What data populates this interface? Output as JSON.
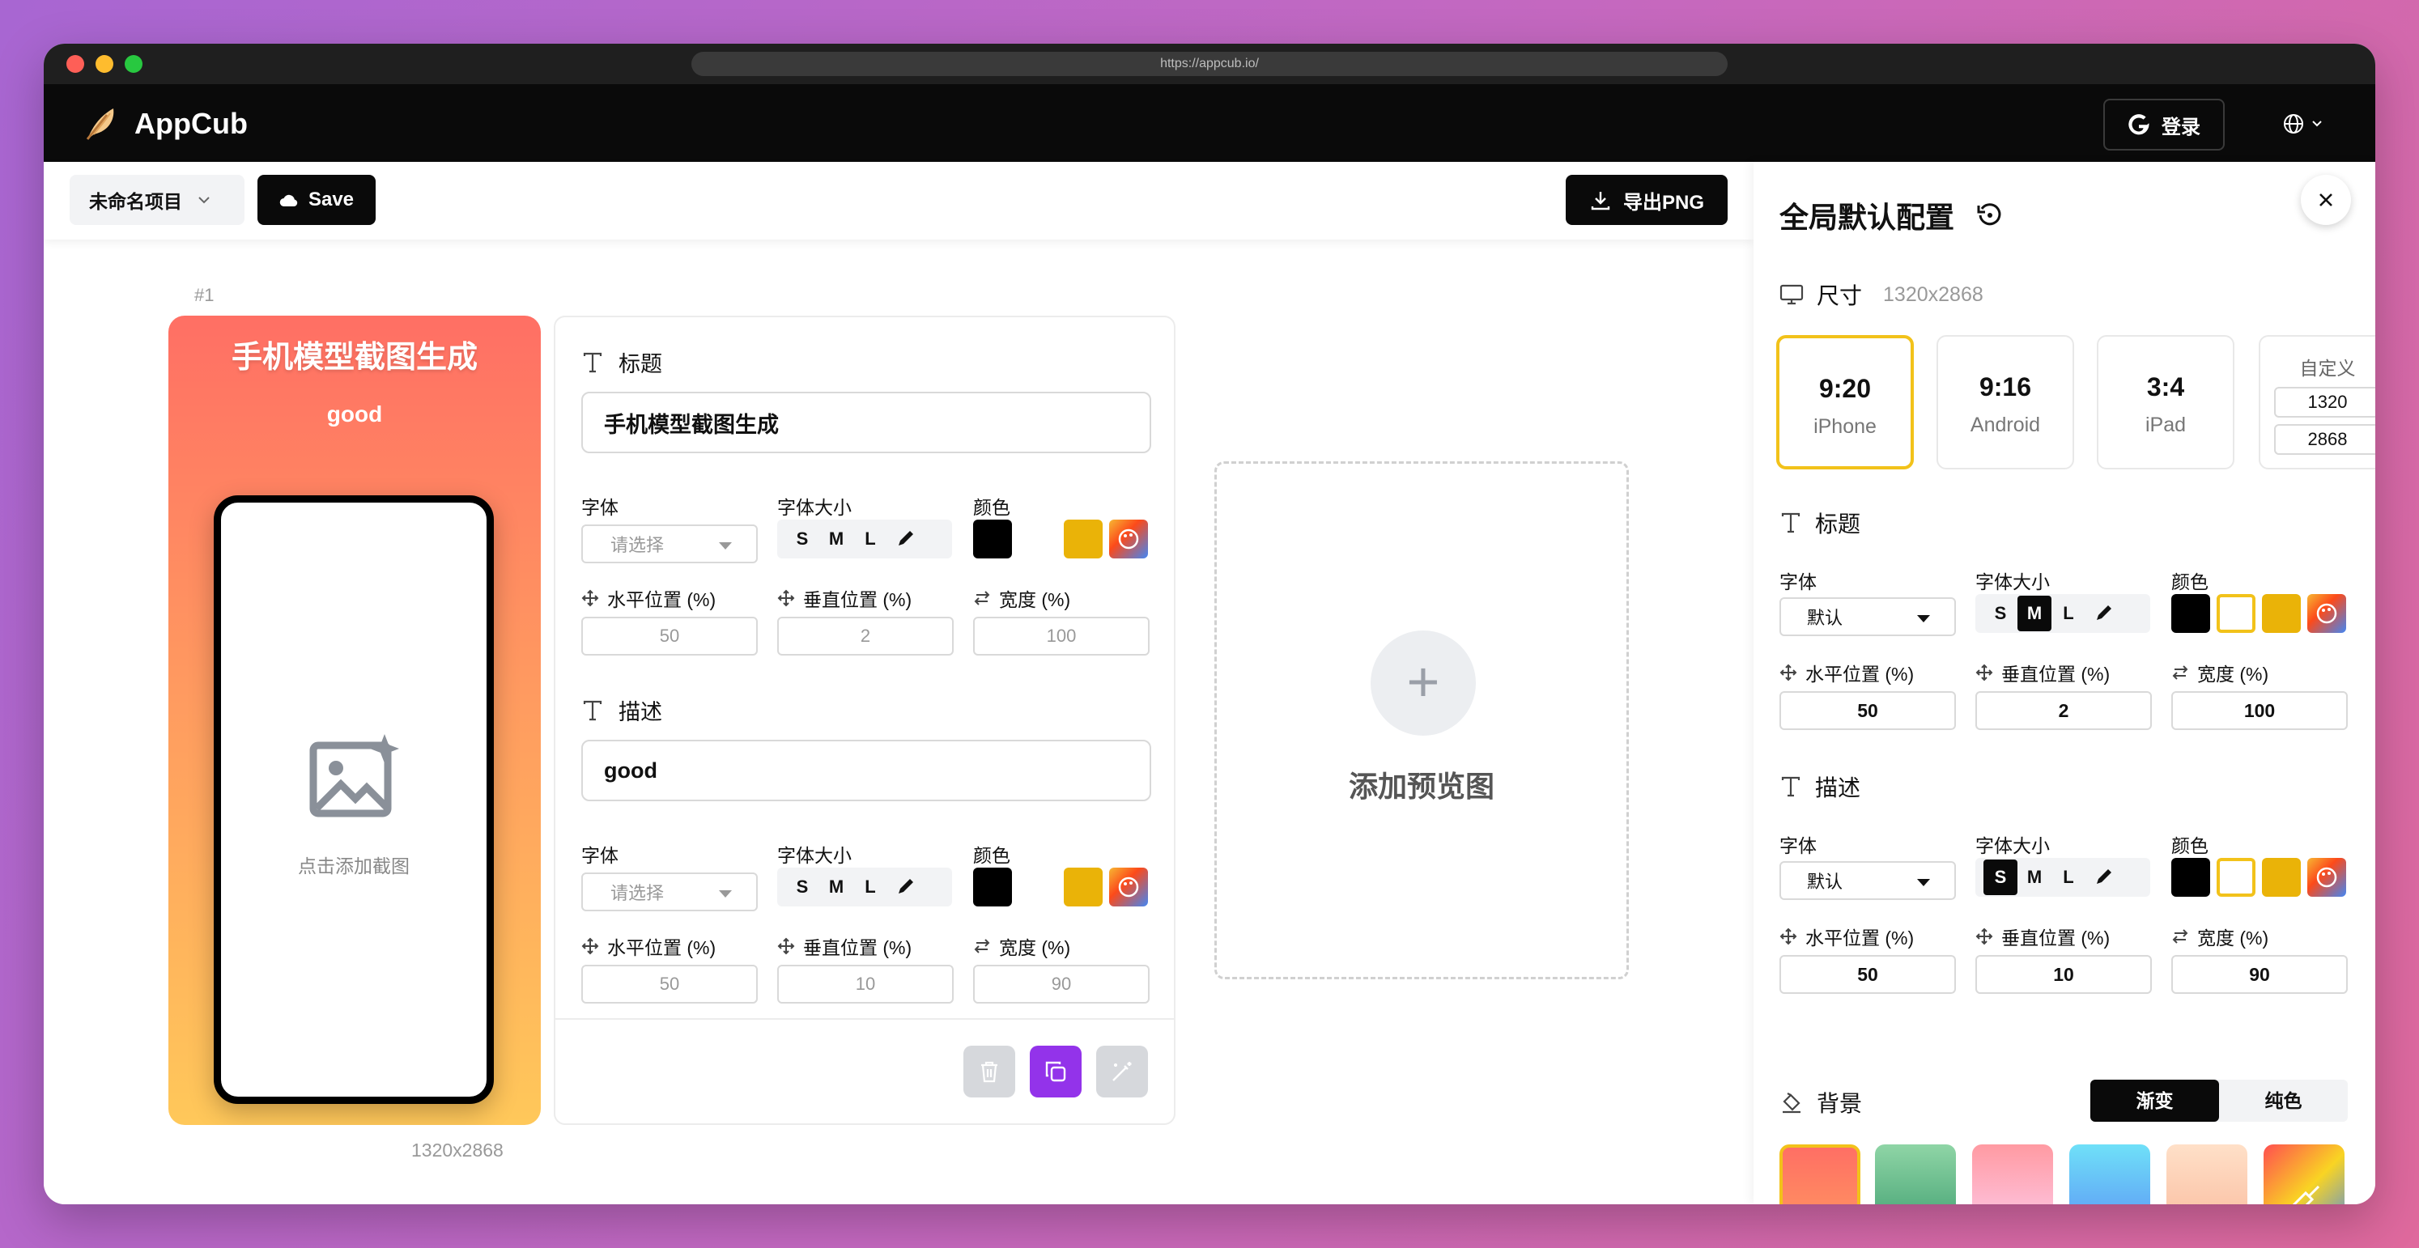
{
  "browser": {
    "url": "https://appcub.io/"
  },
  "app": {
    "name": "AppCub",
    "login": "登录"
  },
  "toolbar": {
    "project": "未命名项目",
    "save": "Save",
    "export": "导出PNG"
  },
  "preview": {
    "index": "#1",
    "title": "手机模型截图生成",
    "description": "good",
    "placeholder": "点击添加截图",
    "size": "1320x2868",
    "gradient": [
      "#ff6f64",
      "#ff9960",
      "#ffc85a"
    ]
  },
  "editor": {
    "title_section": {
      "heading": "标题",
      "value": "手机模型截图生成",
      "font_label": "字体",
      "font_placeholder": "请选择",
      "size_label": "字体大小",
      "sizes": [
        "S",
        "M",
        "L"
      ],
      "color_label": "颜色",
      "x_label": "水平位置 (%)",
      "x": "50",
      "y_label": "垂直位置 (%)",
      "y": "2",
      "w_label": "宽度 (%)",
      "w": "100"
    },
    "desc_section": {
      "heading": "描述",
      "value": "good",
      "font_label": "字体",
      "font_placeholder": "请选择",
      "size_label": "字体大小",
      "sizes": [
        "S",
        "M",
        "L"
      ],
      "color_label": "颜色",
      "x_label": "水平位置 (%)",
      "x": "50",
      "y_label": "垂直位置 (%)",
      "y": "10",
      "w_label": "宽度 (%)",
      "w": "90"
    },
    "swatches": [
      "#000000",
      "#ffffff",
      "#eab308"
    ]
  },
  "add_preview": {
    "label": "添加预览图"
  },
  "panel": {
    "title": "全局默认配置",
    "size_heading": "尺寸",
    "size_value": "1320x2868",
    "ratios": [
      {
        "ratio": "9:20",
        "name": "iPhone",
        "selected": true
      },
      {
        "ratio": "9:16",
        "name": "Android",
        "selected": false
      },
      {
        "ratio": "3:4",
        "name": "iPad",
        "selected": false
      }
    ],
    "custom": {
      "label": "自定义",
      "width": "1320",
      "height": "2868"
    },
    "title_cfg": {
      "heading": "标题",
      "font_label": "字体",
      "font_value": "默认",
      "size_label": "字体大小",
      "sizes": [
        "S",
        "M",
        "L"
      ],
      "size_selected": "M",
      "color_label": "颜色",
      "x_label": "水平位置 (%)",
      "x": "50",
      "y_label": "垂直位置 (%)",
      "y": "2",
      "w_label": "宽度 (%)",
      "w": "100"
    },
    "desc_cfg": {
      "heading": "描述",
      "font_label": "字体",
      "font_value": "默认",
      "size_label": "字体大小",
      "sizes": [
        "S",
        "M",
        "L"
      ],
      "size_selected": "S",
      "color_label": "颜色",
      "x_label": "水平位置 (%)",
      "x": "50",
      "y_label": "垂直位置 (%)",
      "y": "10",
      "w_label": "宽度 (%)",
      "w": "90"
    },
    "bg": {
      "heading": "背景",
      "gradient": "渐变",
      "solid": "纯色"
    },
    "accent": "#f2c21a"
  }
}
